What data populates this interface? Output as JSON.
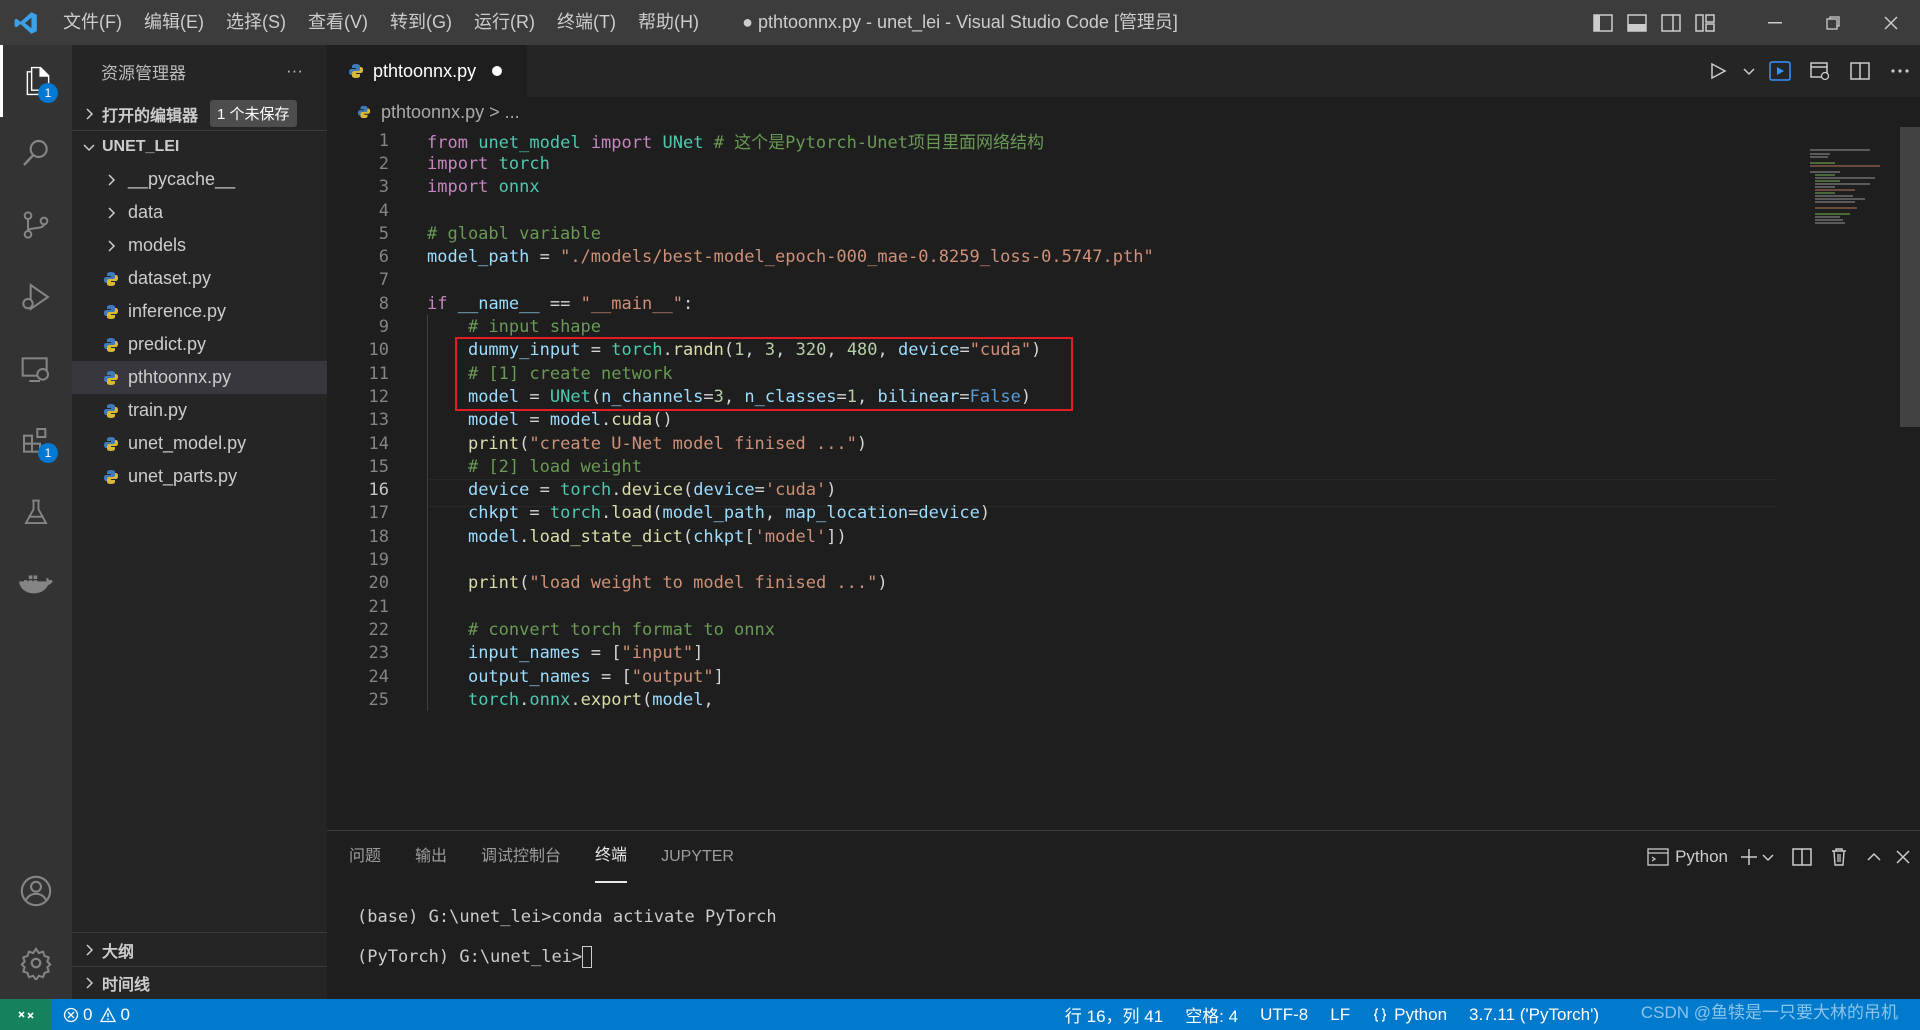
{
  "app": {
    "window_title": "● pthtoonnx.py - unet_lei - Visual Studio Code [管理员]"
  },
  "menu": [
    "文件(F)",
    "编辑(E)",
    "选择(S)",
    "查看(V)",
    "转到(G)",
    "运行(R)",
    "终端(T)",
    "帮助(H)"
  ],
  "activity": {
    "explorer_badge": "1",
    "extensions_badge": "1"
  },
  "sidebar": {
    "title": "资源管理器",
    "more": "···",
    "open_editors_label": "打开的编辑器",
    "unsaved_label": "1 个未保存",
    "folder_label": "UNET_LEI",
    "items": [
      {
        "name": "__pycache__",
        "type": "folder"
      },
      {
        "name": "data",
        "type": "folder"
      },
      {
        "name": "models",
        "type": "folder"
      },
      {
        "name": "dataset.py",
        "type": "py"
      },
      {
        "name": "inference.py",
        "type": "py"
      },
      {
        "name": "predict.py",
        "type": "py"
      },
      {
        "name": "pthtoonnx.py",
        "type": "py"
      },
      {
        "name": "train.py",
        "type": "py"
      },
      {
        "name": "unet_model.py",
        "type": "py"
      },
      {
        "name": "unet_parts.py",
        "type": "py"
      }
    ],
    "outline_label": "大纲",
    "timeline_label": "时间线"
  },
  "editor": {
    "tab_label": "pthtoonnx.py",
    "breadcrumb": "pthtoonnx.py > ...",
    "current_line": 16,
    "line_numbers": [
      "1",
      "2",
      "3",
      "4",
      "5",
      "6",
      "7",
      "8",
      "9",
      "10",
      "11",
      "12",
      "13",
      "14",
      "15",
      "16",
      "17",
      "18",
      "19",
      "20",
      "21",
      "22",
      "23",
      "24",
      "25"
    ],
    "code": [
      "from unet_model import UNet # 这个是Pytorch-Unet项目里面网络结构",
      "import torch",
      "import onnx",
      "",
      "# gloabl variable",
      "model_path = \"./models/best-model_epoch-000_mae-0.8259_loss-0.5747.pth\"",
      "",
      "if __name__ == \"__main__\":",
      "    # input shape",
      "    dummy_input = torch.randn(1, 3, 320, 480, device=\"cuda\")",
      "    # [1] create network",
      "    model = UNet(n_channels=3, n_classes=1, bilinear=False)",
      "    model = model.cuda()",
      "    print(\"create U-Net model finised ...\")",
      "    # [2] load weight",
      "    device = torch.device(device='cuda')",
      "    chkpt = torch.load(model_path, map_location=device)",
      "    model.load_state_dict(chkpt['model'])",
      "",
      "    print(\"load weight to model finised ...\")",
      "",
      "    # convert torch format to onnx",
      "    input_names = [\"input\"]",
      "    output_names = [\"output\"]",
      "    torch.onnx.export(model,"
    ]
  },
  "panel": {
    "tabs": [
      "问题",
      "输出",
      "调试控制台",
      "终端",
      "JUPYTER"
    ],
    "active_tab": "终端",
    "terminal_name": "Python",
    "terminal_lines": [
      "(base) G:\\unet_lei>conda activate PyTorch",
      "(PyTorch) G:\\unet_lei>"
    ]
  },
  "statusbar": {
    "errors": "0",
    "warnings": "0",
    "position": "行 16，列 41",
    "spaces": "空格: 4",
    "encoding": "UTF-8",
    "eol": "LF",
    "language": "Python",
    "interpreter": "3.7.11 ('PyTorch')",
    "watermark": "CSDN @鱼犊是一只要大林的吊机"
  },
  "colors": {
    "accent": "#007acc",
    "highlight_box": "#e51c23"
  }
}
